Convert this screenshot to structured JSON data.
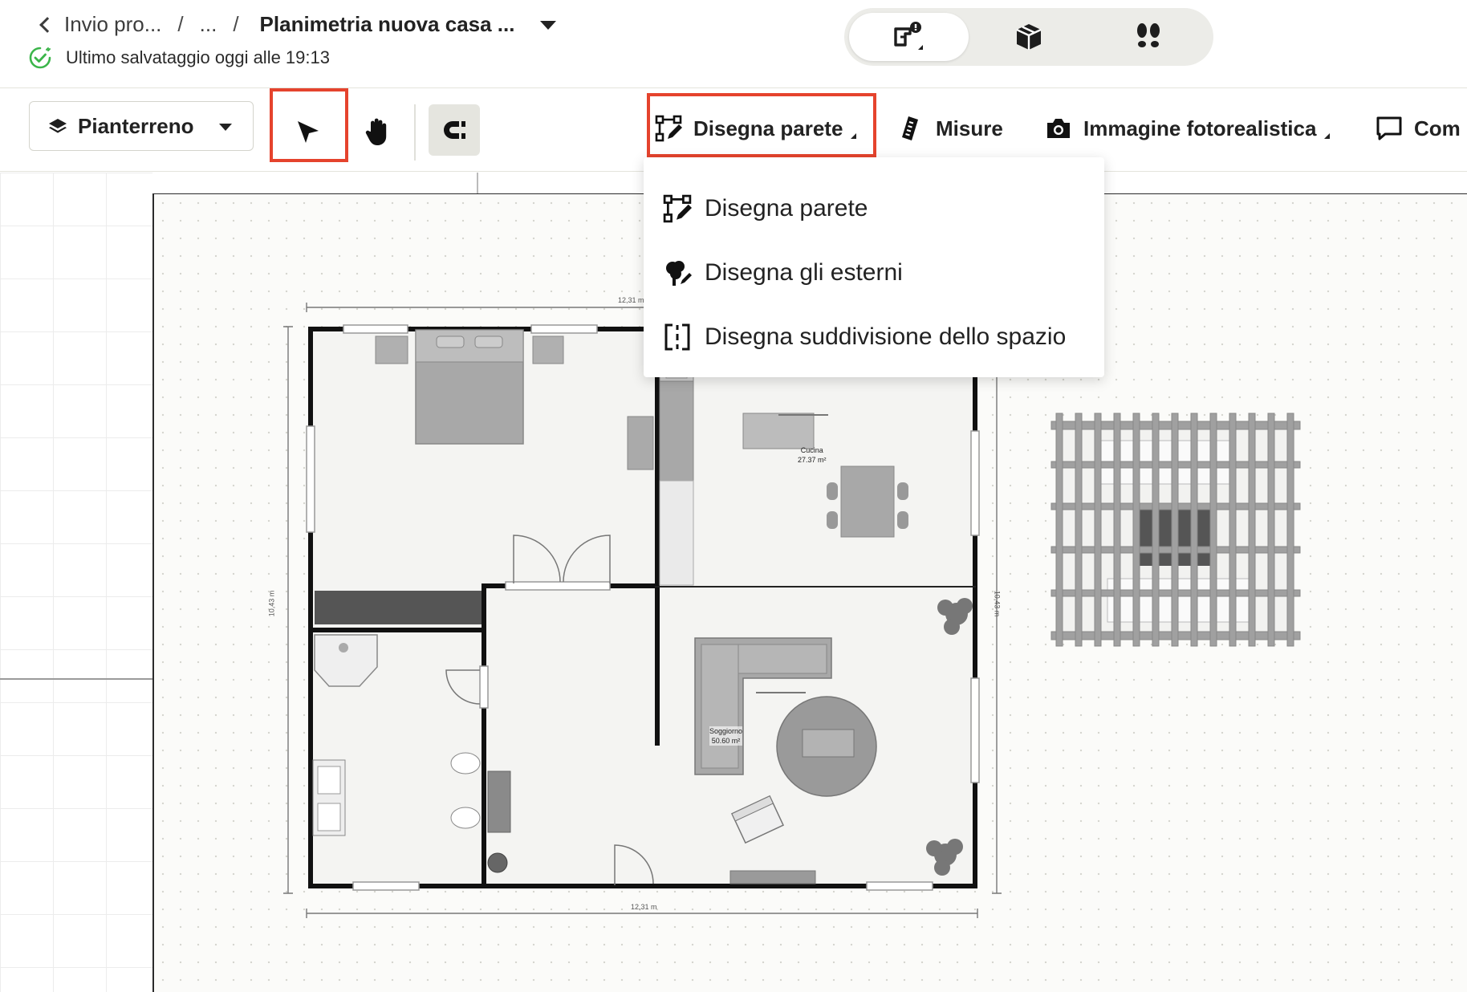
{
  "header": {
    "back_label": "Invio pro...",
    "sep1": "/",
    "ellipsis": "...",
    "sep2": "/",
    "project_title": "Planimetria nuova casa ...",
    "save_status": "Ultimo salvataggio oggi alle 19:13",
    "view_modes": [
      {
        "icon": "2d-plan-icon",
        "active": true
      },
      {
        "icon": "3d-box-icon",
        "active": false
      },
      {
        "icon": "footsteps-icon",
        "active": false
      }
    ]
  },
  "toolbar": {
    "level_label": "Pianterreno",
    "level_icon": "layers-icon",
    "select_tool_icon": "arrow-cursor-icon",
    "pan_tool_icon": "hand-icon",
    "magnet_icon": "magnet-icon",
    "draw_wall_label": "Disegna parete",
    "measures_label": "Misure",
    "photo_label": "Immagine fotorealistica",
    "comment_label": "Com"
  },
  "dropdown": {
    "items": [
      {
        "label": "Disegna parete",
        "icon": "draw-wall-icon"
      },
      {
        "label": "Disegna gli esterni",
        "icon": "draw-outdoor-icon"
      },
      {
        "label": "Disegna suddivisione dello spazio",
        "icon": "space-divider-icon"
      }
    ]
  },
  "floorplan": {
    "dim_top": "12,31 m",
    "dim_bottom": "12,31 m",
    "dim_left": "10,43 m",
    "dim_right": "10,43 m",
    "rooms": [
      {
        "name": "Cucina",
        "area": "27.37 m²"
      },
      {
        "name": "Soggiorno",
        "area": "50.60 m²"
      }
    ]
  },
  "colors": {
    "highlight": "#e5432d",
    "success": "#3bb54a",
    "wall": "#111111",
    "furniture": "#a8a8a8"
  }
}
